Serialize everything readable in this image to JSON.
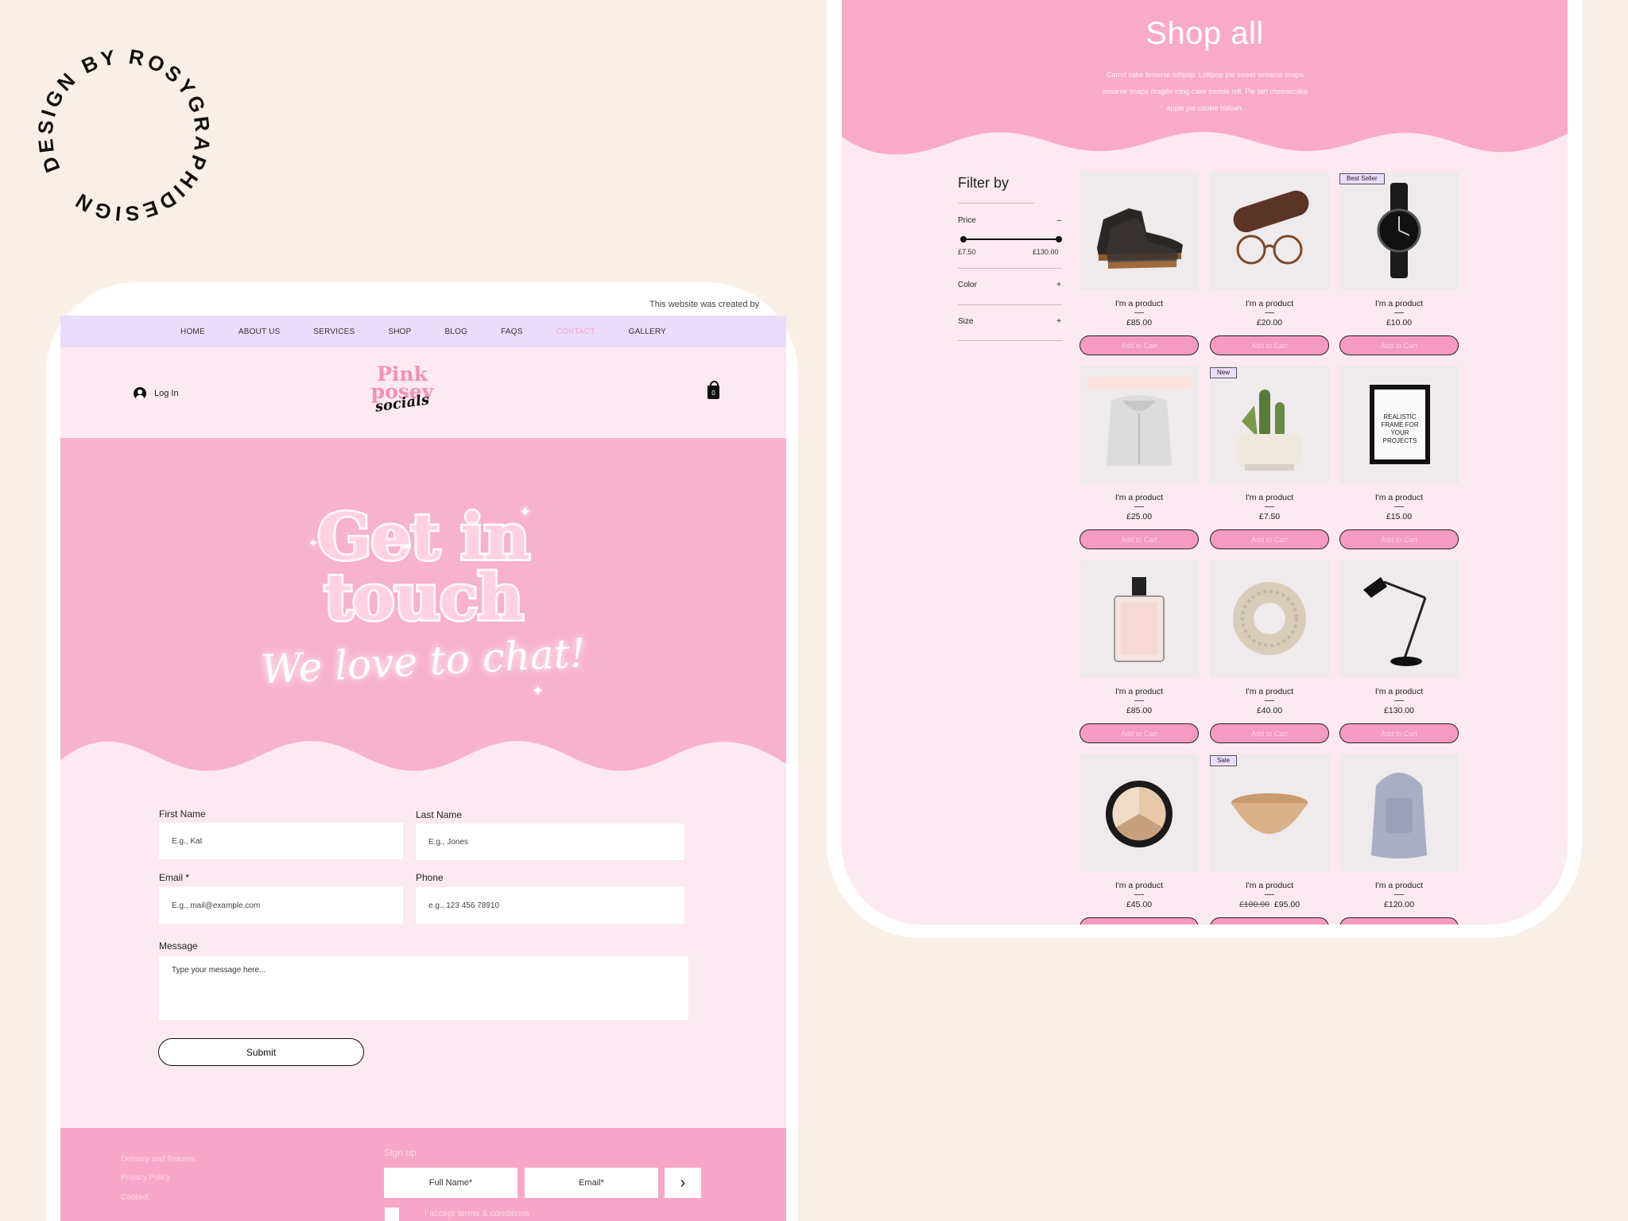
{
  "badge": {
    "text": "DESIGN BY ROSYGRAPHIDESIGN"
  },
  "contact_page": {
    "credit": "This website was created by",
    "nav": [
      "HOME",
      "ABOUT US",
      "SERVICES",
      "SHOP",
      "BLOG",
      "FAQS",
      "CONTACT",
      "GALLERY"
    ],
    "active_nav": "CONTACT",
    "login_label": "Log In",
    "logo": {
      "line1": "Pink",
      "line2": "posey",
      "line3": "socials"
    },
    "cart_count": "0",
    "hero": {
      "title_line1": "Get in",
      "title_line2": "touch",
      "subtitle": "We love to chat!"
    },
    "form": {
      "first_name": {
        "label": "First Name",
        "placeholder": "E.g., Kat"
      },
      "last_name": {
        "label": "Last Name",
        "placeholder": "E.g., Jones"
      },
      "email": {
        "label": "Email *",
        "placeholder": "E.g., mail@example.com"
      },
      "phone": {
        "label": "Phone",
        "placeholder": "e.g., 123 456 78910"
      },
      "message": {
        "label": "Message",
        "placeholder": "Type your message here..."
      },
      "submit_label": "Submit"
    },
    "footer": {
      "links": [
        "Delivery and Returns",
        "Privacy Policy",
        "Contact"
      ],
      "signup_label": "Sign up",
      "full_name_placeholder": "Full Name*",
      "email_placeholder": "Email*",
      "terms_label": "I accept terms & conditions"
    }
  },
  "shop_page": {
    "title": "Shop all",
    "description": "Carrot cake brownie lollipop. Lollipop pie sweet sesame snaps sesame snaps dragée icing cake tootsie roll. Pie tart cheesecake apple pie cookie halvah.",
    "filter": {
      "title": "Filter by",
      "price_label": "Price",
      "price_toggle": "–",
      "price_min": "£7.50",
      "price_max": "£130.00",
      "color_label": "Color",
      "size_label": "Size",
      "expand_icon": "+"
    },
    "add_to_cart_label": "Add to Cart",
    "products": [
      {
        "name": "I'm a product",
        "price": "£85.00",
        "image": "boot-icon"
      },
      {
        "name": "I'm a product",
        "price": "£20.00",
        "image": "glasses-icon"
      },
      {
        "name": "I'm a product",
        "price": "£10.00",
        "image": "watch-icon",
        "tag": "Best Seller"
      },
      {
        "name": "I'm a product",
        "price": "£25.00",
        "image": "hoodie-icon"
      },
      {
        "name": "I'm a product",
        "price": "£7.50",
        "image": "cactus-icon",
        "tag": "New"
      },
      {
        "name": "I'm a product",
        "price": "£15.00",
        "image": "frame-icon",
        "frame_text": "REALISTIC FRAME FOR YOUR PROJECTS"
      },
      {
        "name": "I'm a product",
        "price": "£85.00",
        "image": "perfume-icon"
      },
      {
        "name": "I'm a product",
        "price": "£40.00",
        "image": "scarf-icon"
      },
      {
        "name": "I'm a product",
        "price": "£130.00",
        "image": "lamp-icon"
      },
      {
        "name": "I'm a product",
        "price": "£45.00",
        "image": "palette-icon"
      },
      {
        "name": "I'm a product",
        "price": "£95.00",
        "old_price": "£100.00",
        "image": "bowl-icon",
        "tag": "Sale"
      },
      {
        "name": "I'm a product",
        "price": "£120.00",
        "image": "backpack-icon"
      }
    ]
  },
  "colors": {
    "background": "#f8f0e7",
    "pink": "#f7a6c8",
    "pale_pink": "#fde9f1",
    "lavender": "#eadcfb"
  }
}
